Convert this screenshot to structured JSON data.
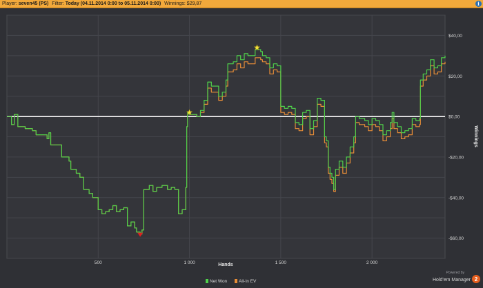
{
  "header": {
    "player_label": "Player:",
    "player_value": "seven45 (PS)",
    "filter_label": "Filter:",
    "filter_value": "Today (04.11.2014 0:00 to 05.11.2014 0:00)",
    "winnings_label": "Winnings:",
    "winnings_value": "$29,87",
    "info_icon": "info-icon"
  },
  "branding": {
    "powered_by": "Powered by",
    "product": "Hold'em Manager",
    "version": "2"
  },
  "chart_data": {
    "type": "line",
    "xlabel": "Hands",
    "ylabel": "Winnings",
    "xlim": [
      0,
      2400
    ],
    "ylim": [
      -70,
      50
    ],
    "x_ticks": [
      500,
      1000,
      1500,
      2000
    ],
    "x_tick_labels": [
      "500",
      "1 000",
      "1 500",
      "2 000"
    ],
    "y_ticks": [
      40,
      20,
      0,
      -20,
      -40,
      -60
    ],
    "y_tick_labels": [
      "$40,00",
      "$20,00",
      "$0,00",
      "-$20,00",
      "-$40,00",
      "-$60,00"
    ],
    "grid": true,
    "legend_position": "bottom-center",
    "zero_line_color": "#ffffff",
    "series": [
      {
        "name": "Net Won",
        "color": "#4fd14a",
        "points": [
          [
            0,
            0
          ],
          [
            25,
            -4
          ],
          [
            40,
            1
          ],
          [
            60,
            -5
          ],
          [
            100,
            -6
          ],
          [
            140,
            -7
          ],
          [
            160,
            -9
          ],
          [
            200,
            -9
          ],
          [
            220,
            -11
          ],
          [
            230,
            -8
          ],
          [
            240,
            -14
          ],
          [
            270,
            -14
          ],
          [
            300,
            -20
          ],
          [
            340,
            -22
          ],
          [
            350,
            -26
          ],
          [
            380,
            -28
          ],
          [
            400,
            -30
          ],
          [
            420,
            -36
          ],
          [
            450,
            -38
          ],
          [
            470,
            -40
          ],
          [
            500,
            -46
          ],
          [
            520,
            -48
          ],
          [
            540,
            -47
          ],
          [
            560,
            -46
          ],
          [
            580,
            -44
          ],
          [
            600,
            -47
          ],
          [
            620,
            -46
          ],
          [
            640,
            -45
          ],
          [
            660,
            -54
          ],
          [
            680,
            -52
          ],
          [
            700,
            -55
          ],
          [
            710,
            -57
          ],
          [
            730,
            -58
          ],
          [
            740,
            -56
          ],
          [
            750,
            -36
          ],
          [
            780,
            -34
          ],
          [
            800,
            -37
          ],
          [
            820,
            -35
          ],
          [
            850,
            -34
          ],
          [
            880,
            -36
          ],
          [
            900,
            -35
          ],
          [
            920,
            -36
          ],
          [
            940,
            -48
          ],
          [
            960,
            -46
          ],
          [
            980,
            -35
          ],
          [
            985,
            -5
          ],
          [
            990,
            2
          ],
          [
            1000,
            1
          ],
          [
            1030,
            1
          ],
          [
            1040,
            0
          ],
          [
            1060,
            3
          ],
          [
            1080,
            8
          ],
          [
            1100,
            17
          ],
          [
            1120,
            15
          ],
          [
            1150,
            15
          ],
          [
            1160,
            10
          ],
          [
            1180,
            12
          ],
          [
            1200,
            18
          ],
          [
            1210,
            26
          ],
          [
            1240,
            27
          ],
          [
            1260,
            30
          ],
          [
            1280,
            28
          ],
          [
            1300,
            31
          ],
          [
            1320,
            30
          ],
          [
            1340,
            30
          ],
          [
            1360,
            33
          ],
          [
            1380,
            33
          ],
          [
            1390,
            32
          ],
          [
            1400,
            30
          ],
          [
            1420,
            29
          ],
          [
            1440,
            24
          ],
          [
            1460,
            26
          ],
          [
            1480,
            25
          ],
          [
            1500,
            5
          ],
          [
            1520,
            4
          ],
          [
            1540,
            5
          ],
          [
            1560,
            4
          ],
          [
            1580,
            -3
          ],
          [
            1600,
            -4
          ],
          [
            1620,
            2
          ],
          [
            1640,
            3
          ],
          [
            1660,
            -6
          ],
          [
            1680,
            -2
          ],
          [
            1700,
            9
          ],
          [
            1720,
            8
          ],
          [
            1740,
            -10
          ],
          [
            1750,
            -12
          ],
          [
            1760,
            -25
          ],
          [
            1770,
            -28
          ],
          [
            1780,
            -30
          ],
          [
            1790,
            -36
          ],
          [
            1800,
            -26
          ],
          [
            1820,
            -22
          ],
          [
            1840,
            -25
          ],
          [
            1860,
            -20
          ],
          [
            1880,
            -15
          ],
          [
            1900,
            -10
          ],
          [
            1910,
            0
          ],
          [
            1930,
            -1
          ],
          [
            1960,
            -2
          ],
          [
            1980,
            -4
          ],
          [
            2000,
            -1
          ],
          [
            2020,
            -2
          ],
          [
            2040,
            -4
          ],
          [
            2060,
            -9
          ],
          [
            2080,
            -7
          ],
          [
            2100,
            -3
          ],
          [
            2110,
            2
          ],
          [
            2120,
            -3
          ],
          [
            2140,
            -5
          ],
          [
            2160,
            -8
          ],
          [
            2180,
            -7
          ],
          [
            2200,
            -6
          ],
          [
            2220,
            -1
          ],
          [
            2240,
            -2
          ],
          [
            2260,
            -1
          ],
          [
            2265,
            18
          ],
          [
            2280,
            21
          ],
          [
            2300,
            23
          ],
          [
            2320,
            28
          ],
          [
            2340,
            24
          ],
          [
            2360,
            25
          ],
          [
            2380,
            29
          ],
          [
            2400,
            30
          ]
        ]
      },
      {
        "name": "All-In EV",
        "color": "#e98e37",
        "points": [
          [
            0,
            0
          ],
          [
            25,
            -4
          ],
          [
            40,
            1
          ],
          [
            60,
            -5
          ],
          [
            100,
            -6
          ],
          [
            140,
            -7
          ],
          [
            160,
            -9
          ],
          [
            200,
            -9
          ],
          [
            220,
            -11
          ],
          [
            230,
            -8
          ],
          [
            240,
            -14
          ],
          [
            270,
            -14
          ],
          [
            300,
            -20
          ],
          [
            340,
            -22
          ],
          [
            350,
            -26
          ],
          [
            380,
            -28
          ],
          [
            400,
            -30
          ],
          [
            420,
            -36
          ],
          [
            450,
            -38
          ],
          [
            470,
            -40
          ],
          [
            500,
            -46
          ],
          [
            520,
            -48
          ],
          [
            540,
            -47
          ],
          [
            560,
            -46
          ],
          [
            580,
            -44
          ],
          [
            600,
            -47
          ],
          [
            620,
            -46
          ],
          [
            640,
            -45
          ],
          [
            660,
            -54
          ],
          [
            680,
            -52
          ],
          [
            700,
            -55
          ],
          [
            710,
            -57
          ],
          [
            730,
            -58
          ],
          [
            740,
            -56
          ],
          [
            750,
            -36
          ],
          [
            780,
            -34
          ],
          [
            800,
            -37
          ],
          [
            820,
            -35
          ],
          [
            850,
            -34
          ],
          [
            880,
            -36
          ],
          [
            900,
            -35
          ],
          [
            920,
            -36
          ],
          [
            940,
            -48
          ],
          [
            960,
            -46
          ],
          [
            980,
            -35
          ],
          [
            985,
            -5
          ],
          [
            990,
            2
          ],
          [
            1000,
            1
          ],
          [
            1030,
            1
          ],
          [
            1040,
            0
          ],
          [
            1060,
            2
          ],
          [
            1080,
            6
          ],
          [
            1100,
            14
          ],
          [
            1120,
            12
          ],
          [
            1150,
            12
          ],
          [
            1160,
            8
          ],
          [
            1180,
            10
          ],
          [
            1200,
            15
          ],
          [
            1210,
            22
          ],
          [
            1240,
            23
          ],
          [
            1260,
            26
          ],
          [
            1280,
            24
          ],
          [
            1300,
            27
          ],
          [
            1320,
            26
          ],
          [
            1340,
            26
          ],
          [
            1360,
            29
          ],
          [
            1380,
            29
          ],
          [
            1390,
            28
          ],
          [
            1400,
            27
          ],
          [
            1420,
            26
          ],
          [
            1440,
            21
          ],
          [
            1460,
            23
          ],
          [
            1480,
            22
          ],
          [
            1500,
            2
          ],
          [
            1520,
            1
          ],
          [
            1540,
            2
          ],
          [
            1560,
            1
          ],
          [
            1580,
            -6
          ],
          [
            1600,
            -7
          ],
          [
            1620,
            -1
          ],
          [
            1640,
            0
          ],
          [
            1660,
            -9
          ],
          [
            1680,
            -5
          ],
          [
            1700,
            6
          ],
          [
            1720,
            5
          ],
          [
            1740,
            -13
          ],
          [
            1750,
            -15
          ],
          [
            1760,
            -28
          ],
          [
            1770,
            -31
          ],
          [
            1780,
            -33
          ],
          [
            1790,
            -37
          ],
          [
            1800,
            -29
          ],
          [
            1820,
            -25
          ],
          [
            1840,
            -28
          ],
          [
            1860,
            -23
          ],
          [
            1880,
            -18
          ],
          [
            1900,
            -13
          ],
          [
            1910,
            -3
          ],
          [
            1930,
            -4
          ],
          [
            1960,
            -5
          ],
          [
            1980,
            -7
          ],
          [
            2000,
            -4
          ],
          [
            2020,
            -5
          ],
          [
            2040,
            -7
          ],
          [
            2060,
            -12
          ],
          [
            2080,
            -10
          ],
          [
            2100,
            -6
          ],
          [
            2110,
            -1
          ],
          [
            2120,
            -6
          ],
          [
            2140,
            -8
          ],
          [
            2160,
            -11
          ],
          [
            2180,
            -10
          ],
          [
            2200,
            -9
          ],
          [
            2220,
            -4
          ],
          [
            2240,
            -5
          ],
          [
            2260,
            -4
          ],
          [
            2265,
            15
          ],
          [
            2280,
            18
          ],
          [
            2300,
            20
          ],
          [
            2320,
            25
          ],
          [
            2340,
            21
          ],
          [
            2360,
            22
          ],
          [
            2380,
            26
          ],
          [
            2400,
            27
          ]
        ]
      }
    ],
    "markers": [
      {
        "name": "max-marker",
        "shape": "star",
        "color": "#f4e23a",
        "x": 1370,
        "y": 34
      },
      {
        "name": "start-positive-marker",
        "shape": "star",
        "color": "#f4e23a",
        "x": 1000,
        "y": 2
      },
      {
        "name": "min-marker",
        "shape": "triangle-down",
        "color": "#e02020",
        "x": 730,
        "y": -58
      }
    ]
  }
}
